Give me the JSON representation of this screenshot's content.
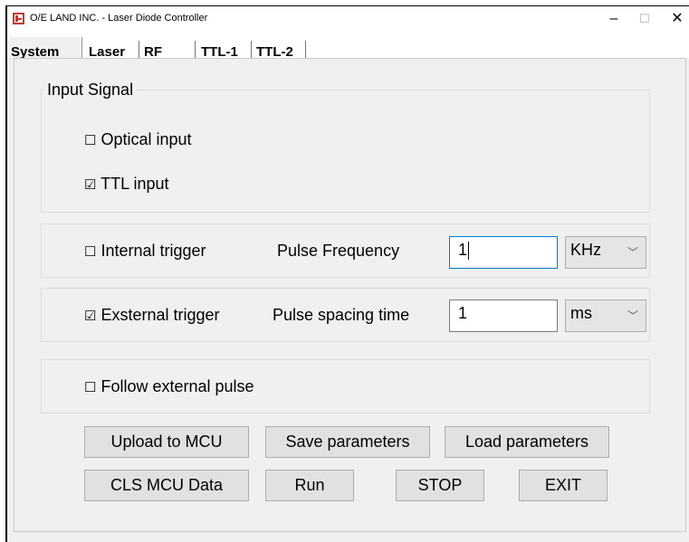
{
  "window": {
    "title": "O/E LAND INC. - Laser Diode Controller",
    "minimize": "–",
    "maximize": "☐",
    "close": "✕"
  },
  "tabs": [
    "System",
    "Laser",
    "RF",
    "TTL-1",
    "TTL-2"
  ],
  "input_signal": {
    "title": "Input Signal",
    "optical": {
      "label": "Optical input",
      "checked": false
    },
    "ttl": {
      "label": "TTL input",
      "checked": true
    }
  },
  "internal": {
    "label": "Internal trigger",
    "checked": false,
    "freq_label": "Pulse Frequency",
    "freq_value": "1",
    "freq_unit": "KHz"
  },
  "external": {
    "label": "Exsternal trigger",
    "checked": true,
    "spacing_label": "Pulse spacing time",
    "spacing_value": "1",
    "spacing_unit": "ms"
  },
  "follow": {
    "label": "Follow external pulse",
    "checked": false
  },
  "buttons": {
    "upload": "Upload to MCU",
    "save": "Save parameters",
    "load": "Load parameters",
    "cls": "CLS MCU Data",
    "run": "Run",
    "stop": "STOP",
    "exit": "EXIT"
  },
  "glyphs": {
    "unchecked": "☐",
    "checked": "☑",
    "chevron": "﹀"
  },
  "colors": {
    "focus_border": "#0078d7",
    "icon": "#c0392b"
  }
}
